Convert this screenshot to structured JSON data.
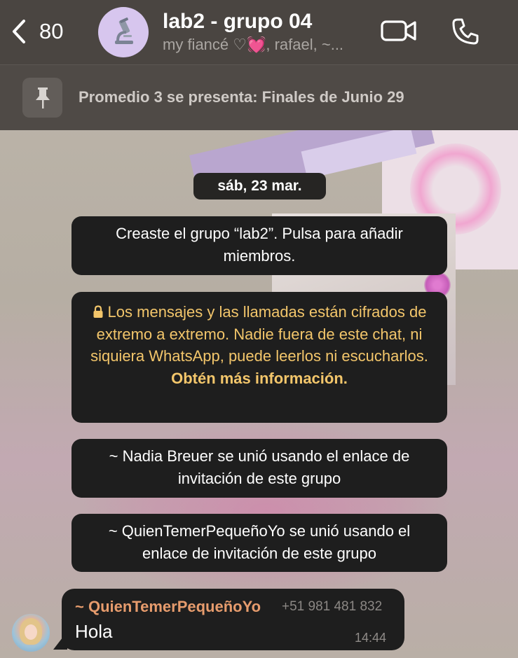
{
  "header": {
    "back_count": "80",
    "title": "lab2 - grupo 04",
    "subtitle": "my fiancé ♡💓, rafael, ~...",
    "avatar_icon": "microscope-icon"
  },
  "pinned": {
    "icon": "pin-icon",
    "text": "Promedio 3 se presenta: Finales de Junio 29"
  },
  "chat": {
    "date": "sáb, 23 mar.",
    "system_messages": [
      "Creaste el grupo “lab2”. Pulsa para añadir miembros.",
      "~ Nadia Breuer se unió usando el enlace de invitación de este grupo",
      "~ QuienTemerPequeñoYo se unió usando el enlace de invitación de este grupo"
    ],
    "encryption": {
      "icon": "lock-icon",
      "text": "Los mensajes y las llamadas están cifrados de extremo a extremo. Nadie fuera de este chat, ni siquiera WhatsApp, puede leerlos ni escucharlos.",
      "link": "Obtén más información."
    },
    "message": {
      "sender": "~ QuienTemerPequeñoYo",
      "phone": "+51 981 481 832",
      "text": "Hola",
      "time": "14:44"
    }
  },
  "colors": {
    "header_bg": "#4a4541",
    "bubble_bg": "#1e1e1e",
    "encryption_text": "#f3c66b",
    "sender_name": "#e79c6d"
  }
}
